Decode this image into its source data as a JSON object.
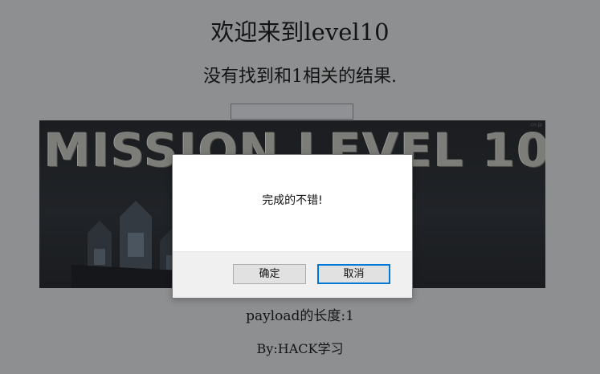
{
  "page": {
    "title": "欢迎来到level10",
    "result_text": "没有找到和1相关的结果.",
    "search_value": "",
    "banner_title": "MISSION LEVEL 10",
    "payload_length": "payload的长度:1",
    "byline": "By:HACK学习"
  },
  "dialog": {
    "message": "完成的不错!",
    "ok_label": "确定",
    "cancel_label": "取消"
  },
  "colors": {
    "page_background": "#8e8f91",
    "dialog_background": "#ffffff",
    "dialog_footer": "#f0f0f0",
    "focus_border": "#0078d7",
    "banner_background": "#1d1f23"
  }
}
